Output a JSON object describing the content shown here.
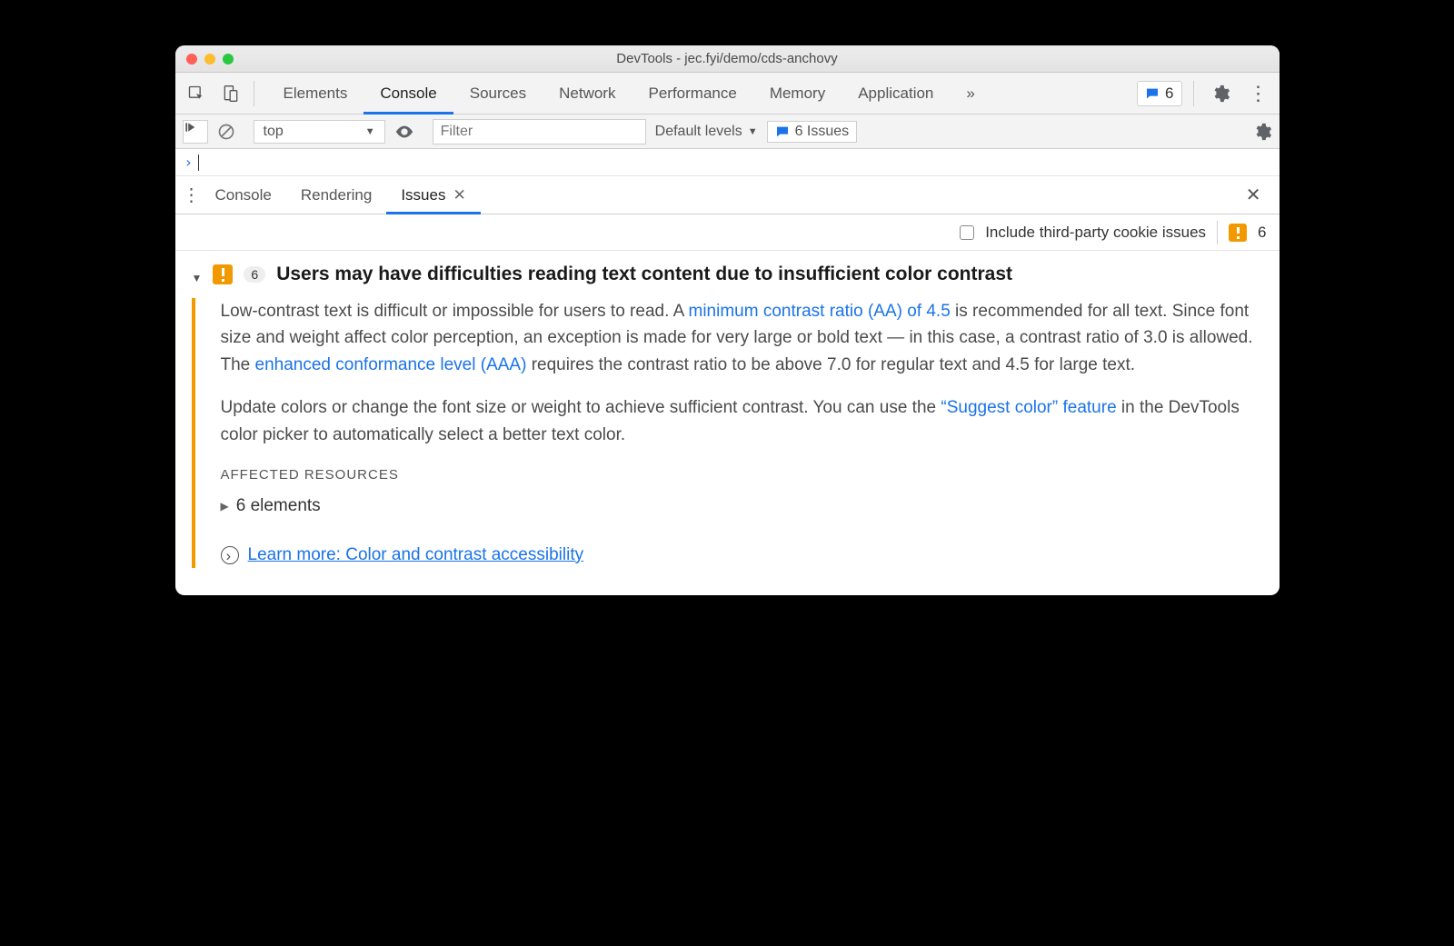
{
  "window_title": "DevTools - jec.fyi/demo/cds-anchovy",
  "main_tabs": [
    "Elements",
    "Console",
    "Sources",
    "Network",
    "Performance",
    "Memory",
    "Application"
  ],
  "main_tabs_active": 1,
  "issues_count_toolbar": "6",
  "filter": {
    "context": "top",
    "placeholder": "Filter",
    "levels": "Default levels",
    "issues_label": "6 Issues"
  },
  "prompt_symbol": "›",
  "drawer_tabs": [
    "Console",
    "Rendering",
    "Issues"
  ],
  "drawer_tabs_active": 2,
  "include_row": {
    "label": "Include third-party cookie issues",
    "count": "6"
  },
  "issue": {
    "count": "6",
    "title": "Users may have difficulties reading text content due to insufficient color contrast",
    "p1a": "Low-contrast text is difficult or impossible for users to read. A ",
    "link1": "minimum contrast ratio (AA) of 4.5",
    "p1b": " is recommended for all text. Since font size and weight affect color perception, an exception is made for very large or bold text — in this case, a contrast ratio of 3.0 is allowed. The ",
    "link2": "enhanced conformance level (AAA)",
    "p1c": " requires the contrast ratio to be above 7.0 for regular text and 4.5 for large text.",
    "p2a": "Update colors or change the font size or weight to achieve sufficient contrast. You can use the ",
    "link3": "“Suggest color” feature",
    "p2b": " in the DevTools color picker to automatically select a better text color.",
    "affected_label": "AFFECTED RESOURCES",
    "affected_elements": "6 elements",
    "learn_more": "Learn more: Color and contrast accessibility"
  }
}
